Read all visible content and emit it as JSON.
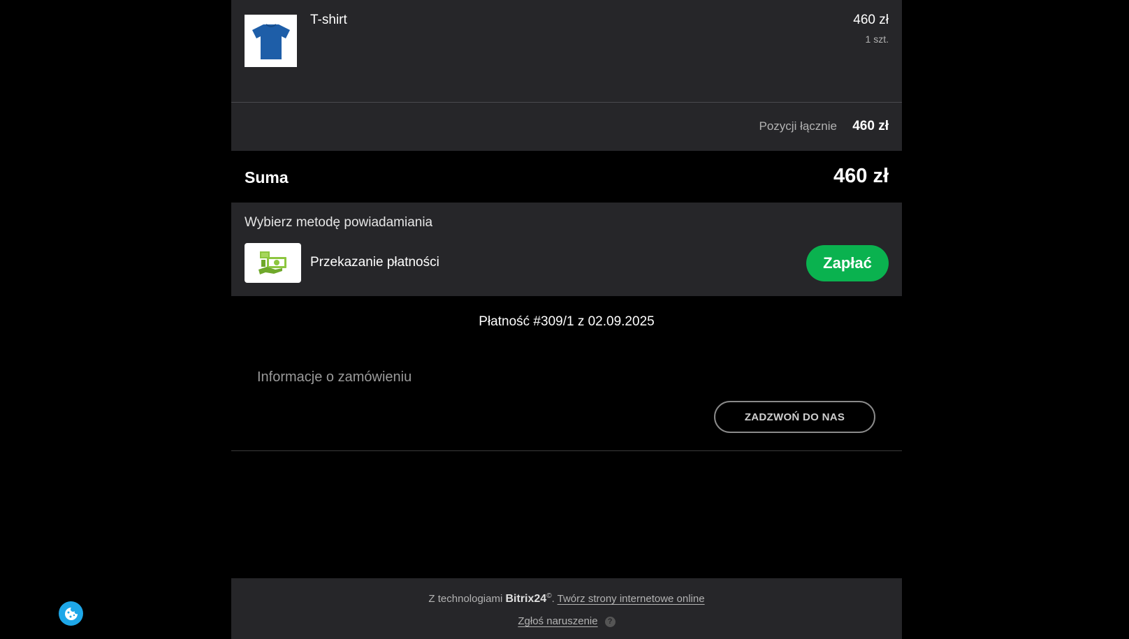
{
  "product": {
    "name": "T-shirt",
    "price": "460 zł",
    "quantity": "1 szt.",
    "image_icon": "tshirt-icon"
  },
  "subtotal": {
    "label": "Pozycji łącznie",
    "value": "460 zł"
  },
  "total": {
    "label": "Suma",
    "value": "460 zł"
  },
  "payment": {
    "title": "Wybierz metodę powiadamiania",
    "method_label": "Przekazanie płatności",
    "method_icon": "money-transfer-icon",
    "pay_button": "Zapłać"
  },
  "payment_id": "Płatność #309/1 z 02.09.2025",
  "order_info": {
    "title": "Informacje o zamówieniu",
    "call_button": "ZADZWOŃ DO NAS"
  },
  "footer": {
    "prefix": "Z technologiami",
    "brand": "Bitrix24",
    "copyright_mark": "©",
    "link_text": "Twórz strony internetowe online",
    "report_link": "Zgłoś naruszenie",
    "help_icon": "question-icon"
  },
  "colors": {
    "accent_green": "#0ab24f",
    "panel": "#262629",
    "background": "#000000",
    "cookie_button": "#1ea7e8",
    "tshirt": "#1e5ea8"
  }
}
